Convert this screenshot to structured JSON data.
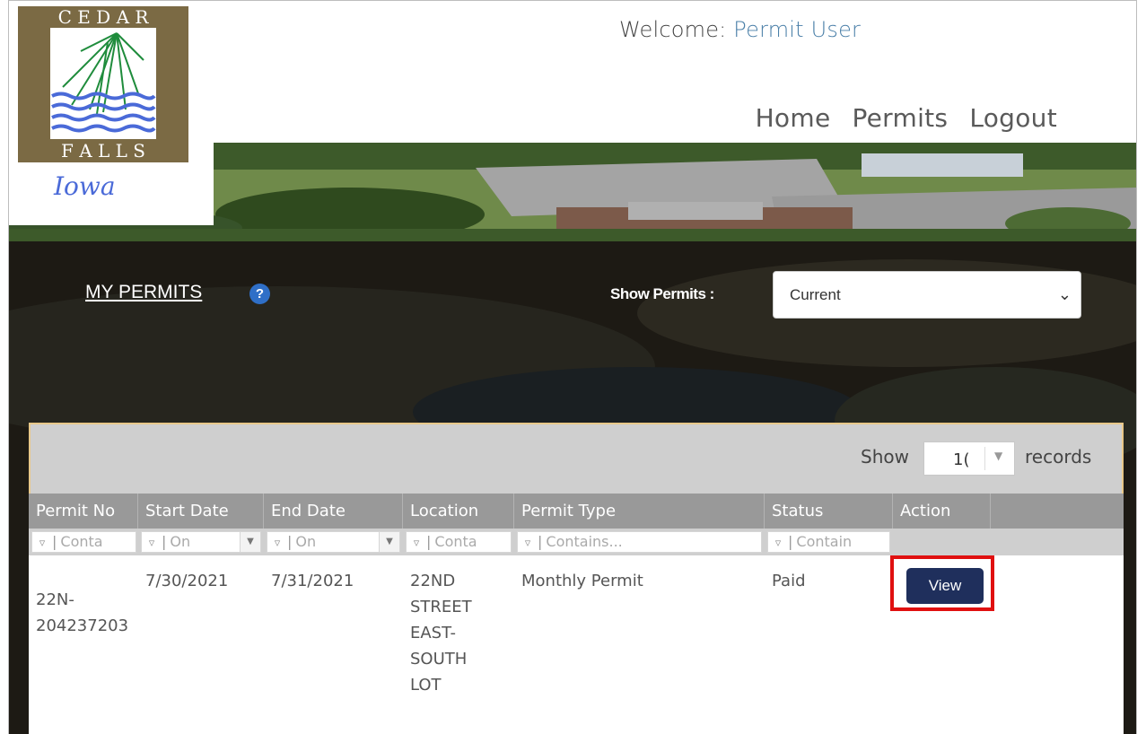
{
  "logo": {
    "top_text": "C E D A R",
    "bottom_text": "F A L L S",
    "script_text": "Iowa"
  },
  "header": {
    "welcome_prefix": "Welcome: ",
    "welcome_user": "Permit User",
    "nav": [
      "Home",
      "Permits",
      "Logout"
    ]
  },
  "toolbar": {
    "title": "MY PERMITS",
    "help_icon": "?",
    "show_permits_label": "Show Permits :",
    "show_permits_value": "Current"
  },
  "grid": {
    "records": {
      "show_label": "Show",
      "page_size": "1(",
      "records_label": "records"
    },
    "columns": [
      "Permit No",
      "Start Date",
      "End Date",
      "Location",
      "Permit Type",
      "Status",
      "Action"
    ],
    "filters": [
      "Conta",
      "On",
      "On",
      "Conta",
      "Contains...",
      "Contain"
    ],
    "rows": [
      {
        "permit_no": "22N-\n204237203",
        "start_date": "7/30/2021",
        "end_date": "7/31/2021",
        "location": "22ND\nSTREET\nEAST-\nSOUTH\nLOT",
        "permit_type": "Monthly Permit",
        "status": "Paid",
        "action": "View"
      }
    ]
  },
  "colors": {
    "view_button": "#1f2f5c",
    "highlight": "#e01010",
    "header_row": "#999999",
    "help_icon": "#2f6fc7"
  }
}
